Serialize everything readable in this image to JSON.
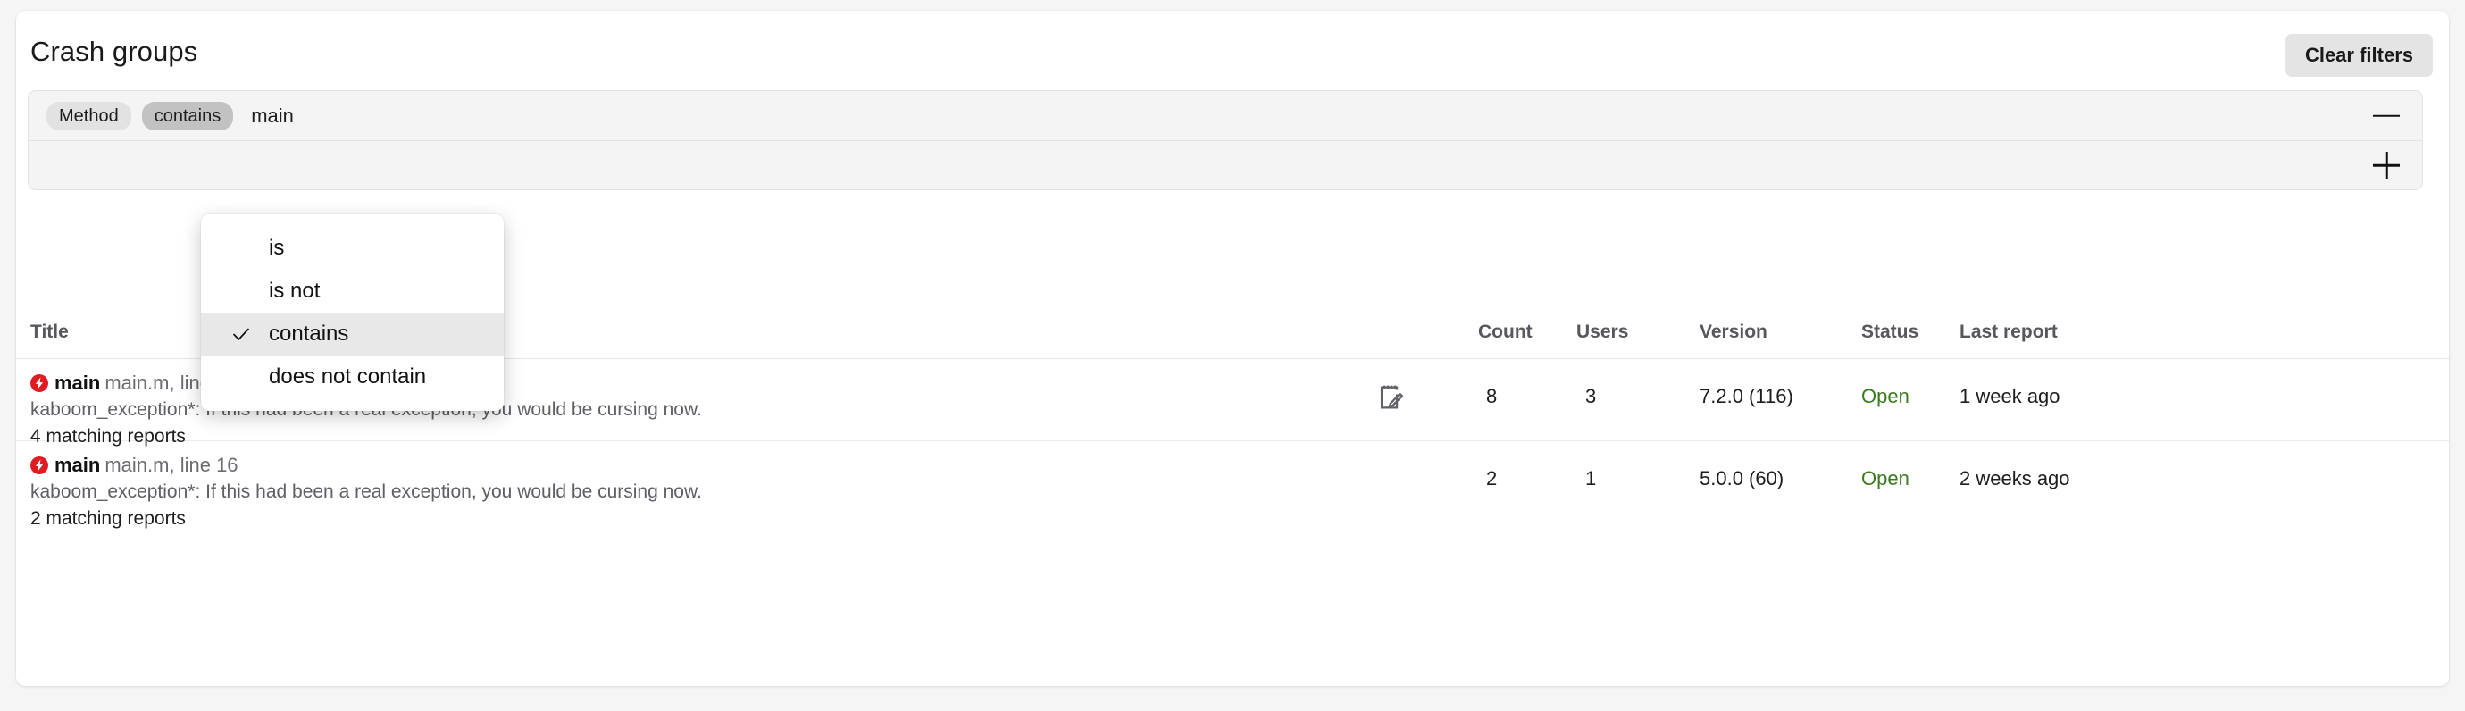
{
  "header": {
    "title": "Crash groups",
    "clear_filters_label": "Clear filters"
  },
  "filters": {
    "rows": [
      {
        "field_chip": "Method",
        "operator_chip": "contains",
        "value": "main",
        "action_icon": "minus-icon"
      },
      {
        "field_chip": "",
        "operator_chip": "",
        "value": "",
        "action_icon": "plus-icon"
      }
    ]
  },
  "operator_dropdown": {
    "open": true,
    "selected": "contains",
    "options": [
      {
        "label": "is",
        "checked": false
      },
      {
        "label": "is not",
        "checked": false
      },
      {
        "label": "contains",
        "checked": true
      },
      {
        "label": "does not contain",
        "checked": false
      }
    ]
  },
  "table": {
    "columns": {
      "title": "Title",
      "count": "Count",
      "users": "Users",
      "version": "Version",
      "status": "Status",
      "last_report": "Last report"
    },
    "rows": [
      {
        "icon": "crash-error-icon",
        "method": "main",
        "location": "main.m, line 16",
        "exception": "kaboom_exception*: If this had been a real exception, you would be cursing now.",
        "matching": "4 matching reports",
        "note_icon": "note-edit-icon",
        "has_note": true,
        "count": "8",
        "users": "3",
        "version": "7.2.0 (116)",
        "status": "Open",
        "last_report": "1 week ago"
      },
      {
        "icon": "crash-error-icon",
        "method": "main",
        "location": "main.m, line 16",
        "exception": "kaboom_exception*: If this had been a real exception, you would be cursing now.",
        "matching": "2 matching reports",
        "note_icon": "",
        "has_note": false,
        "count": "2",
        "users": "1",
        "version": "5.0.0 (60)",
        "status": "Open",
        "last_report": "2 weeks ago"
      }
    ]
  },
  "colors": {
    "status_open": "#3a7a1e",
    "crash_icon_red": "#e01c22",
    "chip_field_bg": "#e2e2e2",
    "chip_operator_bg": "#c2c2c2",
    "button_bg": "#e4e4e5"
  }
}
